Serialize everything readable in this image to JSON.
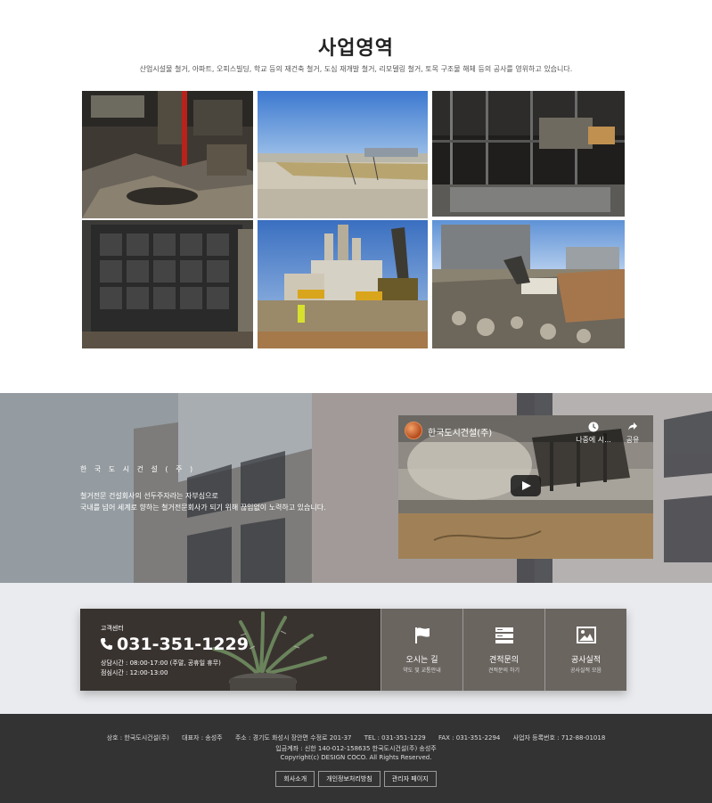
{
  "business": {
    "title": "사업영역",
    "description": "산업시설물 철거, 아파트, 오피스빌딩, 학교 등의 재건축 철거, 도심 재개발 철거, 리모델링 철거, 토목 구조물 해체 등의 공사를 영위하고 있습니다."
  },
  "banner": {
    "company": "한 국 도 시 건 설 ( 주 )",
    "line1": "철거전문 건설회사의 선두주자라는 자부심으로",
    "line2": "국내를 넘어 세계로 향하는 철거전문회사가 되기 위해 끊임없이 노력하고 있습니다."
  },
  "video": {
    "channel_title": "한국도시건설(주)",
    "watch_later": "나중에 시...",
    "share": "공유"
  },
  "customer_center": {
    "label": "고객센터",
    "phone": "031-351-1229",
    "hours": "상담시간 : 08:00-17:00 (주말, 공휴일 휴무)",
    "lunch": "점심시간 : 12:00-13:00"
  },
  "quick_links": [
    {
      "title": "오시는 길",
      "subtitle": "약도 및 교통안내",
      "icon": "flag-icon"
    },
    {
      "title": "견적문의",
      "subtitle": "견적문의 하기",
      "icon": "server-icon"
    },
    {
      "title": "공사실적",
      "subtitle": "공사실적 모음",
      "icon": "image-icon"
    }
  ],
  "footer": {
    "company": "상호 : 한국도시건설(주)",
    "ceo": "대표자 : 송성주",
    "address": "주소 : 경기도 화성시 장안면 수정로 201-37",
    "tel": "TEL : 031-351-1229",
    "fax": "FAX : 031-351-2294",
    "biz_no": "사업자 등록번호 : 712-88-01018",
    "account": "입금계좌 : 신한 140-012-158635 한국도시건설(주) 송성주",
    "copyright": "Copyright(c) DESIGN COCO. All Rights Reserved.",
    "buttons": [
      "회사소개",
      "개인정보처리방침",
      "관리자 페이지"
    ]
  },
  "colors": {
    "footer_bg": "#333333",
    "cs_wrap_bg": "#e9ebee",
    "quick_link_bg": "#6b6560"
  }
}
